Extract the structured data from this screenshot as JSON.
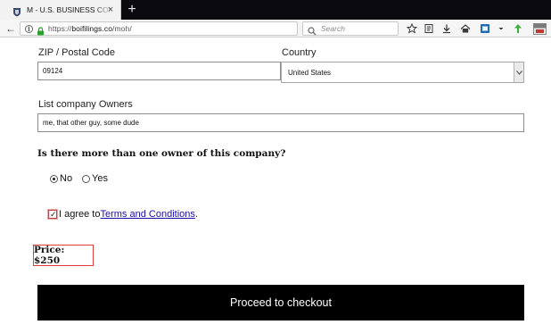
{
  "browser": {
    "tab_title": "M - U.S. BUSINESS COMPLIANCE",
    "url_prefix": "https://",
    "url_host": "boifilings.co",
    "url_path": "/moh/",
    "search_placeholder": "Search",
    "icons": [
      "favicon-icon",
      "close-icon",
      "new-tab-icon",
      "back-icon",
      "info-icon",
      "lock-icon",
      "search-icon",
      "star-icon",
      "reading-list-icon",
      "download-icon",
      "home-icon",
      "pocket-icon",
      "overflow-icon",
      "upload-arrow-icon",
      "extension-icon"
    ]
  },
  "form": {
    "zip_label": "ZIP / Postal Code",
    "zip_value": "09124",
    "country_label": "Country",
    "country_value": "United States",
    "owners_label": "List company Owners",
    "owners_value": "me, that other guy, some dude",
    "question": "Is there more than one owner of this company?",
    "option_no": "No",
    "option_yes": "Yes",
    "selected_option": "No",
    "agree_prefix": "I agree to ",
    "terms_link": "Terms and Conditions",
    "agree_suffix": ".",
    "agree_checked": true,
    "price": "Price: $250",
    "checkout_label": "Proceed to checkout"
  },
  "colors": {
    "price_border": "#e53b3b",
    "link": "#1a0dab",
    "button_bg": "#000000",
    "upload_arrow": "#3fae3f"
  }
}
